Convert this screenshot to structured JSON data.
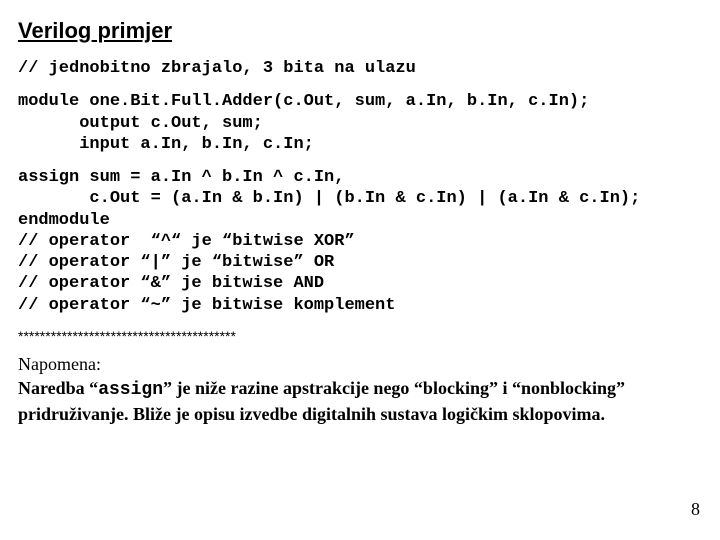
{
  "title": "Verilog primjer",
  "code": {
    "comment_top": "// jednobitno zbrajalo, 3 bita na ulazu",
    "decl1": "module one.Bit.Full.Adder(c.Out, sum, a.In, b.In, c.In);",
    "decl2": "      output c.Out, sum;",
    "decl3": "      input a.In, b.In, c.In;",
    "assign1": "assign sum = a.In ^ b.In ^ c.In,",
    "assign2": "       c.Out = (a.In & b.In) | (b.In & c.In) | (a.In & c.In);",
    "end": "endmodule",
    "op1": "// operator  “^“ je “bitwise XOR”",
    "op2": "// operator “|” je “bitwise” OR",
    "op3": "// operator “&” je bitwise AND",
    "op4": "// operator “~” je bitwise komplement"
  },
  "stars": "****************************************",
  "note": {
    "label": "Napomena:",
    "pre": "Naredba “",
    "mono": "assign",
    "post": "” je niže razine apstrakcije nego “blocking” i “nonblocking” pridruživanje. Bliže je opisu izvedbe digitalnih sustava logičkim sklopovima."
  },
  "page": "8"
}
